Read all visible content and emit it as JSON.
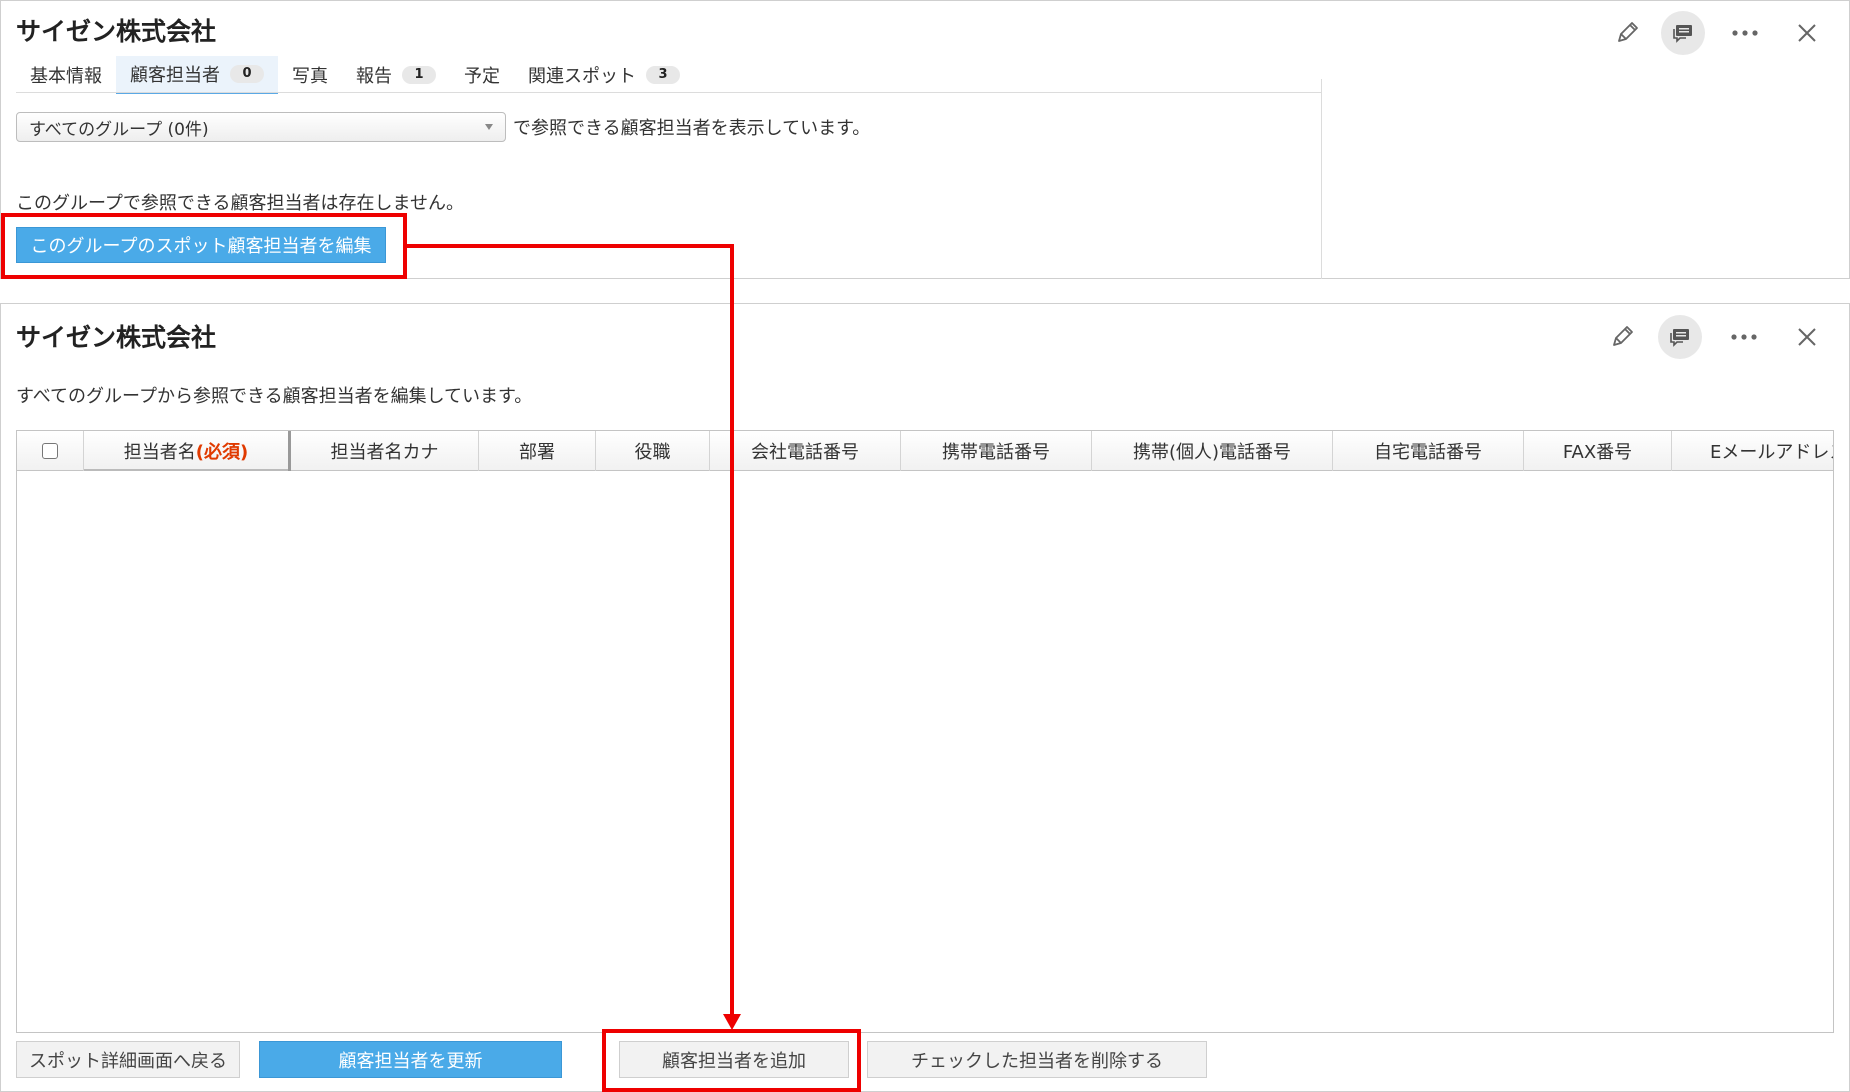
{
  "top_panel": {
    "title": "サイゼン株式会社",
    "tabs": [
      {
        "label": "基本情報",
        "count": ""
      },
      {
        "label": "顧客担当者",
        "count": "0"
      },
      {
        "label": "写真",
        "count": ""
      },
      {
        "label": "報告",
        "count": "1"
      },
      {
        "label": "予定",
        "count": ""
      },
      {
        "label": "関連スポット",
        "count": "3"
      }
    ],
    "group_select": {
      "value": "すべてのグループ (0件)"
    },
    "select_suffix": "で参照できる顧客担当者を表示しています。",
    "empty_message": "このグループで参照できる顧客担当者は存在しません。",
    "edit_group_button": "このグループのスポット顧客担当者を編集"
  },
  "bottom_panel": {
    "title": "サイゼン株式会社",
    "description": "すべてのグループから参照できる顧客担当者を編集しています。",
    "columns": {
      "name": "担当者名",
      "required": "(必須)",
      "kana": "担当者名カナ",
      "department": "部署",
      "position": "役職",
      "company_phone": "会社電話番号",
      "mobile_phone": "携帯電話番号",
      "personal_mobile": "携帯(個人)電話番号",
      "home_phone": "自宅電話番号",
      "fax": "FAX番号",
      "email": "Eメールアドレス"
    },
    "buttons": {
      "back": "スポット詳細画面へ戻る",
      "update": "顧客担当者を更新",
      "add": "顧客担当者を追加",
      "delete_checked": "チェックした担当者を削除する"
    }
  },
  "icons": [
    "pencil-icon",
    "comment-icon",
    "more-icon",
    "close-icon"
  ],
  "colors": {
    "accent_blue": "#4aaae8",
    "highlight_red": "#ee0000",
    "required_text": "#e03a00"
  }
}
